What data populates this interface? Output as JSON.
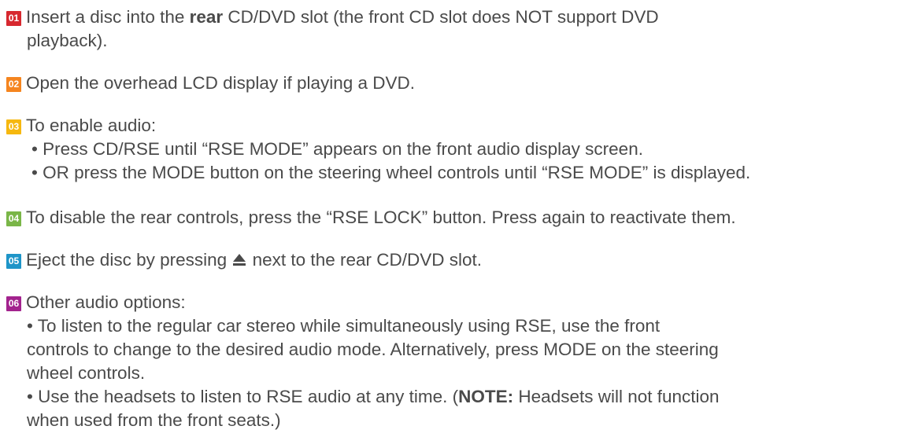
{
  "steps": [
    {
      "number": "01",
      "color": "#d7282f",
      "line1_pre": "Insert a disc into the ",
      "line1_bold": "rear",
      "line1_post": " CD/DVD slot (the front CD slot does NOT support DVD",
      "line2": "playback)."
    },
    {
      "number": "02",
      "color": "#f5851f",
      "text": "Open the overhead LCD display if playing a DVD."
    },
    {
      "number": "03",
      "color": "#f6b80f",
      "text": "To enable audio:",
      "bullets": [
        "• Press CD/RSE until “RSE MODE” appears on the front audio display screen.",
        "• OR press the MODE button on the steering wheel controls until “RSE MODE” is displayed."
      ]
    },
    {
      "number": "04",
      "color": "#7ab648",
      "text": "To disable the rear controls, press the “RSE LOCK” button. Press again to reactivate them."
    },
    {
      "number": "05",
      "color": "#1e95c8",
      "text_pre": "Eject the disc by pressing ",
      "icon": "eject-icon",
      "text_post": " next to the rear CD/DVD slot."
    },
    {
      "number": "06",
      "color": "#a3238e",
      "text": "Other audio options:",
      "para1": [
        "• To listen to the regular car stereo while simultaneously using RSE, use the front",
        "controls to change to the desired audio mode. Alternatively, press MODE on the steering",
        "wheel controls."
      ],
      "para2_pre": "• Use the headsets to listen to RSE audio at any time. (",
      "para2_bold": "NOTE:",
      "para2_post": " Headsets will not function",
      "para2_line2": "when used from the front seats.)"
    }
  ]
}
